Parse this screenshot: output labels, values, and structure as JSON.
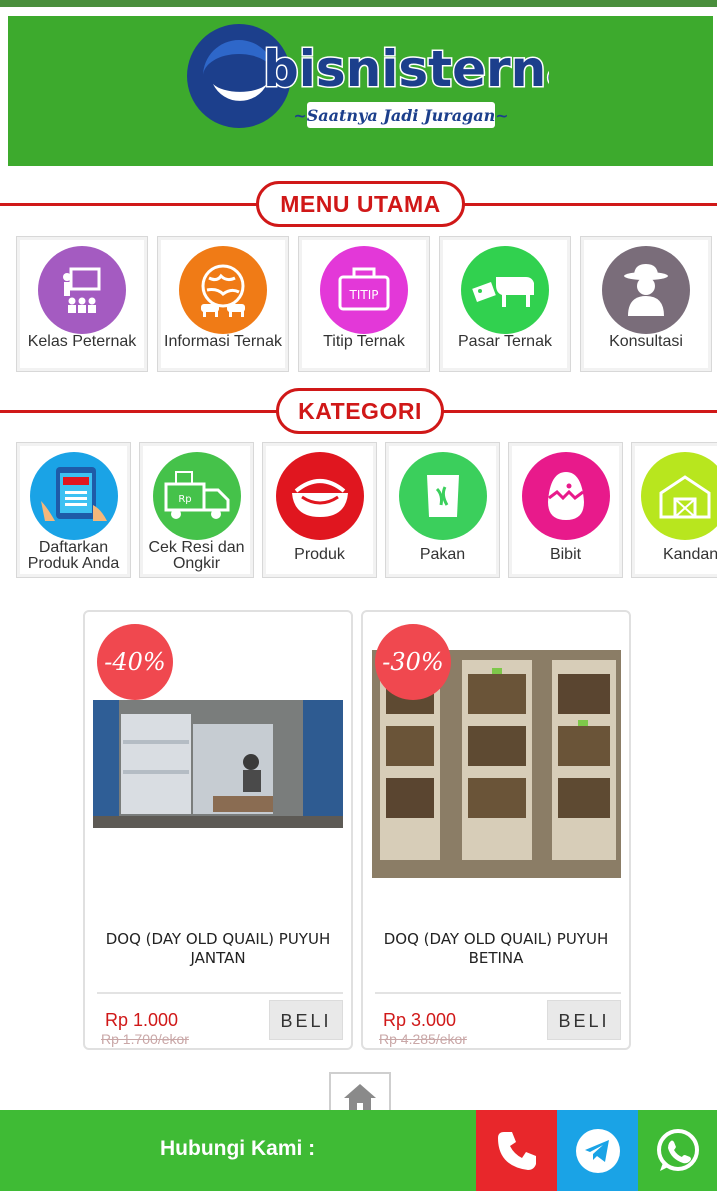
{
  "banner": {
    "brand": "bisnisternak.id",
    "tagline": "~Saatnya Jadi Juragan~"
  },
  "menu_utama": {
    "title": "MENU UTAMA",
    "items": [
      {
        "label": "Kelas Peternak",
        "icon": "presentation-class-icon",
        "color": "#a45bc1"
      },
      {
        "label": "Informasi Ternak",
        "icon": "globe-livestock-icon",
        "color": "#f07b16"
      },
      {
        "label": "Titip Ternak",
        "icon": "briefcase-titip-icon",
        "color": "#e338d8"
      },
      {
        "label": "Pasar Ternak",
        "icon": "cow-price-tag-icon",
        "color": "#31d14f"
      },
      {
        "label": "Konsultasi",
        "icon": "farmer-avatar-icon",
        "color": "#7a6d7a"
      }
    ]
  },
  "kategori": {
    "title": "KATEGORI",
    "items": [
      {
        "label": "Daftarkan Produk Anda",
        "icon": "tablet-register-icon",
        "color": "#1aa3e6"
      },
      {
        "label": "Cek Resi dan Ongkir",
        "icon": "delivery-truck-icon",
        "color": "#45c24a"
      },
      {
        "label": "Produk",
        "icon": "roast-chicken-basket-icon",
        "color": "#e0161f"
      },
      {
        "label": "Pakan",
        "icon": "feed-sack-icon",
        "color": "#3bcf5c"
      },
      {
        "label": "Bibit",
        "icon": "hatching-egg-icon",
        "color": "#e81a8b"
      },
      {
        "label": "Kandang",
        "icon": "barn-icon",
        "color": "#b8e61e"
      }
    ]
  },
  "products": [
    {
      "discount": "-40%",
      "name": "DOQ (DAY OLD QUAIL) PUYUH JANTAN",
      "price": "Rp 1.000",
      "old_price": "Rp 1.700/ekor",
      "buy_label": "BELI"
    },
    {
      "discount": "-30%",
      "name": "DOQ (DAY OLD QUAIL) PUYUH BETINA",
      "price": "Rp 3.000",
      "old_price": "Rp 4.285/ekor",
      "buy_label": "BELI"
    }
  ],
  "footer": {
    "label": "Hubungi Kami :",
    "buttons": [
      {
        "icon": "phone-icon",
        "color": "#e8272b"
      },
      {
        "icon": "telegram-icon",
        "color": "#1aa3e6"
      },
      {
        "icon": "whatsapp-icon",
        "color": "#3fbb35"
      }
    ]
  },
  "colors": {
    "accent_red": "#d01818",
    "brand_green": "#3daa2d"
  }
}
